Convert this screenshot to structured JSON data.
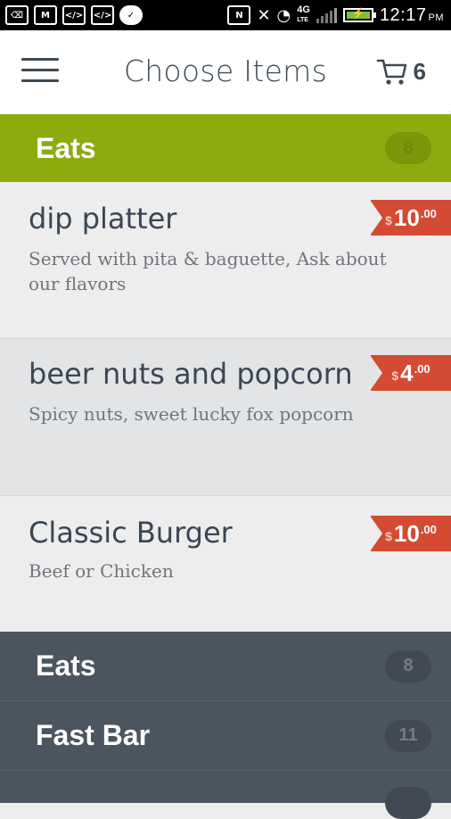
{
  "status_bar": {
    "time": "12:17",
    "ampm": "PM",
    "network": "4G",
    "network_sub": "LTE"
  },
  "header": {
    "title": "Choose Items",
    "cart_count": "6"
  },
  "active_category": {
    "name": "Eats",
    "count": "8"
  },
  "items": [
    {
      "name": "dip platter",
      "description": "Served with pita & baguette, Ask about our flavors",
      "currency": "$",
      "price": "10",
      "cents": ".00"
    },
    {
      "name": "beer nuts and popcorn",
      "description": "Spicy nuts, sweet lucky fox popcorn",
      "currency": "$",
      "price": "4",
      "cents": ".00"
    },
    {
      "name": "Classic Burger",
      "description": "Beef or Chicken",
      "currency": "$",
      "price": "10",
      "cents": ".00"
    }
  ],
  "categories": [
    {
      "name": "Eats",
      "count": "8"
    },
    {
      "name": "Fast Bar",
      "count": "11"
    },
    {
      "name": "",
      "count": ""
    }
  ],
  "colors": {
    "accent_green": "#8eab0e",
    "price_red": "#d44a33",
    "dark_slate": "#4b5560"
  }
}
